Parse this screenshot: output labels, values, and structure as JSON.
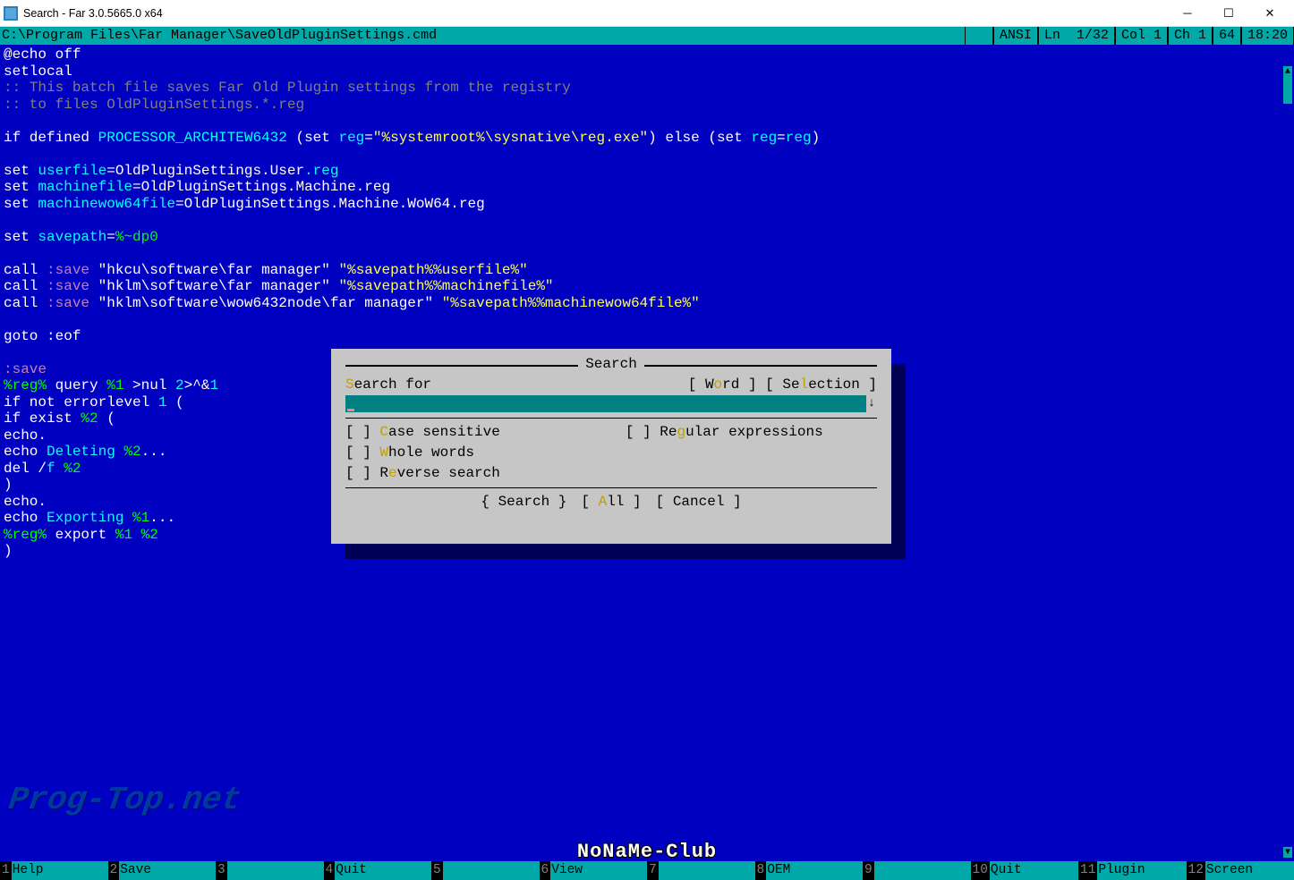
{
  "window": {
    "title": "Search - Far 3.0.5665.0 x64"
  },
  "topbar": {
    "path": "C:\\Program Files\\Far Manager\\SaveOldPluginSettings.cmd",
    "encoding": "ANSI",
    "line": "Ln  1/32",
    "col": "Col 1",
    "ch": "Ch 1",
    "cp": "64",
    "time": "18:20"
  },
  "code": {
    "l01a": "@echo off",
    "l02a": "setlocal",
    "l03a": ":: This batch file saves Far Old Plugin settings from the registry",
    "l04a": ":: to files OldPluginSettings.*.reg",
    "l05a": "",
    "l06_if": "if defined ",
    "l06_var": "PROCESSOR_ARCHITEW6432",
    "l06_set1": " (set ",
    "l06_reg": "reg",
    "l06_eq": "=",
    "l06_str": "\"%systemroot%\\sysnative\\reg.exe\"",
    "l06_else": ") else (set ",
    "l06_reg2": "reg",
    "l06_eq2": "=",
    "l06_reg3": "reg",
    "l06_close": ")",
    "l_set": "set ",
    "userfile": "userfile",
    "uf_val": "=OldPluginSettings.User",
    "uf_ext": ".reg",
    "machinefile": "machinefile",
    "mf_val": "=OldPluginSettings.Machine.reg",
    "wow64file": "machinewow64file",
    "wf_val": "=OldPluginSettings.Machine.WoW64.reg",
    "savepath": "savepath",
    "sp_eq": "=",
    "sp_val": "%~dp0",
    "call": "call ",
    "save_label": ":save",
    "call1_a": " \"hkcu\\software\\far manager\" ",
    "call1_b": "\"%savepath%%userfile%\"",
    "call2_a": " \"hklm\\software\\far manager\" ",
    "call2_b": "\"%savepath%%machinefile%\"",
    "call3_a": " \"hklm\\software\\wow6432node\\far manager\" ",
    "call3_b": "\"%savepath%%machinewow64file%\"",
    "goto": "goto :eof",
    "savel": ":save",
    "pctreg": "%reg%",
    "query": " query ",
    "pct1": "%1",
    "nul": " >nul ",
    "two": "2",
    "amp": ">^&",
    "one": "1",
    "ifnot": "if not errorlevel ",
    "lvl1": "1",
    "paren": " (",
    "ifex": "if exist ",
    "pct2": "%2",
    "paren2": " (",
    "echo": "echo.",
    "echoD": "echo ",
    "deleting": "Deleting ",
    "dots": "...",
    "del": "del /",
    "f": "f",
    "cp": ")",
    "exporting": "Exporting ",
    "export": " export "
  },
  "dialog": {
    "title": " Search ",
    "search_for": "earch for",
    "word_pre": "[ W",
    "word_h": "o",
    "word_post": "rd ]",
    "sel_pre": " [ Se",
    "sel_h": "l",
    "sel_post": "ection ]",
    "cs_pre": "[ ] ",
    "cs_h": "C",
    "cs_post": "ase sensitive",
    "re_pre": "[ ] Re",
    "re_h": "g",
    "re_post": "ular expressions",
    "ww_pre": "[ ] ",
    "ww_h": "W",
    "ww_post": "hole words",
    "rv_pre": "[ ] R",
    "rv_h": "e",
    "rv_post": "verse search",
    "btn_search": "{ Search }",
    "btn_all_pre": "[ ",
    "btn_all_h": "A",
    "btn_all_post": "ll ]",
    "btn_cancel": "[ Cancel ]"
  },
  "keybar": [
    {
      "n": "1",
      "l": "Help"
    },
    {
      "n": "2",
      "l": "Save"
    },
    {
      "n": "3",
      "l": ""
    },
    {
      "n": "4",
      "l": "Quit"
    },
    {
      "n": "5",
      "l": ""
    },
    {
      "n": "6",
      "l": "View"
    },
    {
      "n": "7",
      "l": ""
    },
    {
      "n": "8",
      "l": "OEM"
    },
    {
      "n": "9",
      "l": ""
    },
    {
      "n": "10",
      "l": "Quit"
    },
    {
      "n": "11",
      "l": "Plugin"
    },
    {
      "n": "12",
      "l": "Screen"
    }
  ],
  "watermark1": "Prog-Top.net",
  "watermark2": "NoNaMe-Club"
}
